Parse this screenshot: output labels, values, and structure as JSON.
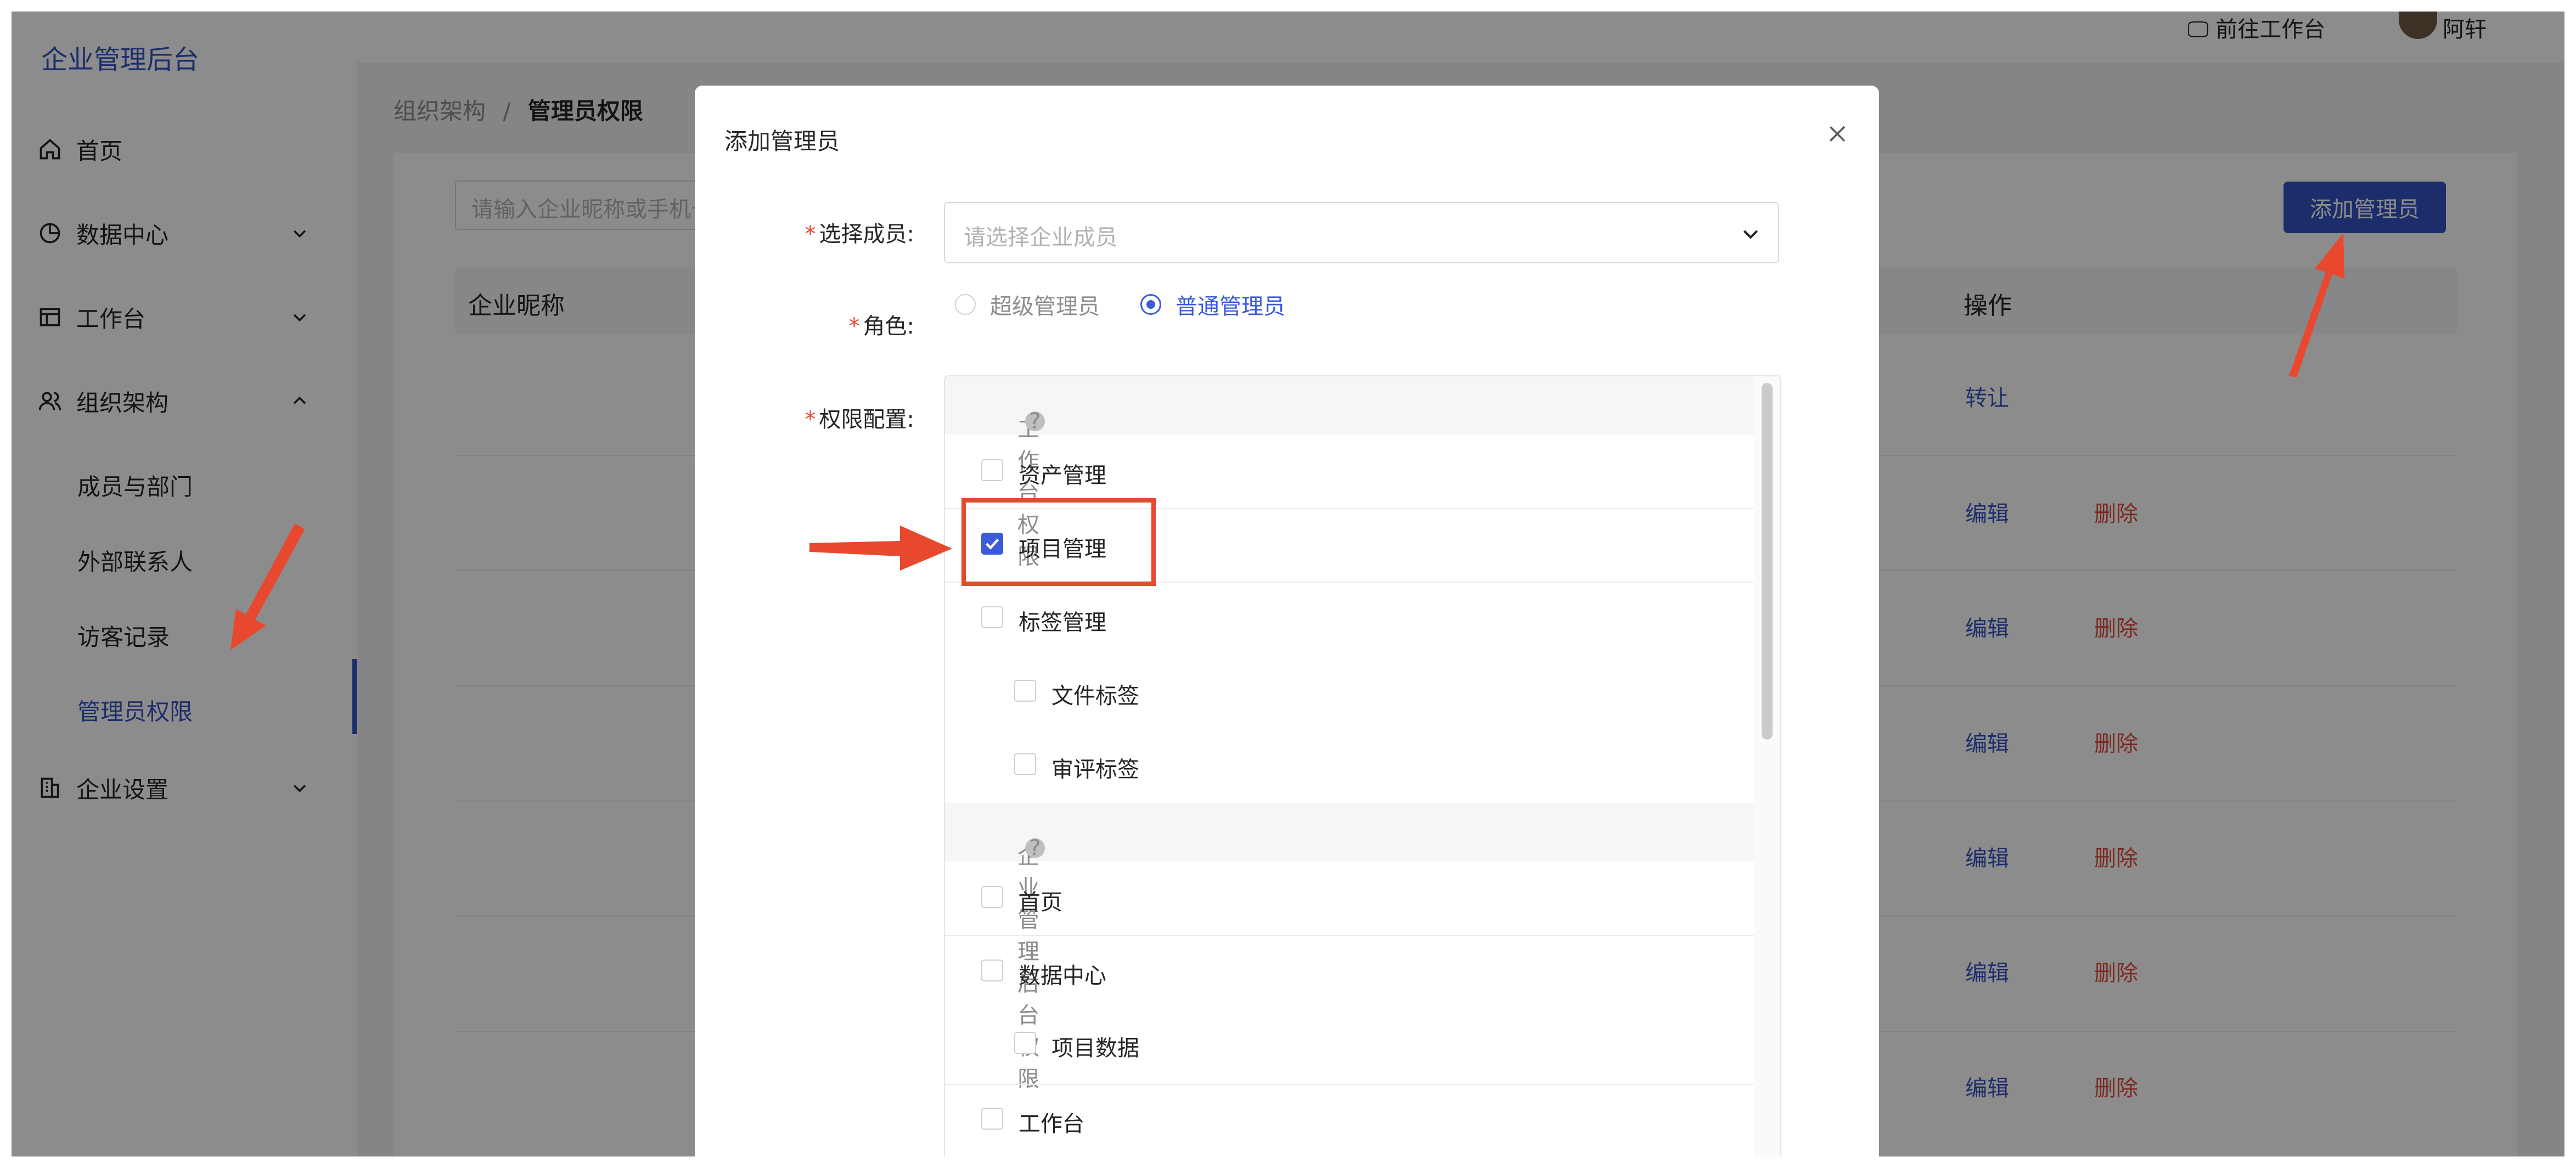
{
  "sidebar": {
    "brand": "企业管理后台",
    "items": [
      {
        "label": "首页",
        "icon": "home-icon"
      },
      {
        "label": "数据中心",
        "icon": "pie-chart-icon"
      },
      {
        "label": "工作台",
        "icon": "workbench-icon"
      },
      {
        "label": "组织架构",
        "icon": "users-icon"
      },
      {
        "label": "企业设置",
        "icon": "building-icon"
      }
    ],
    "sub_items": [
      "成员与部门",
      "外部联系人",
      "访客记录",
      "管理员权限"
    ]
  },
  "header": {
    "link": "前往工作台",
    "user": "阿轩"
  },
  "breadcrumb": {
    "parent": "组织架构",
    "separator": "/",
    "current": "管理员权限"
  },
  "page": {
    "search_placeholder": "请输入企业昵称或手机号",
    "add_button": "添加管理员",
    "columns": {
      "name": "企业昵称",
      "operation": "操作"
    },
    "rows": [
      {
        "action": "转让"
      },
      {
        "edit": "编辑",
        "delete": "删除"
      },
      {
        "edit": "编辑",
        "delete": "删除"
      },
      {
        "edit": "编辑",
        "delete": "删除"
      },
      {
        "edit": "编辑",
        "delete": "删除"
      },
      {
        "edit": "编辑",
        "delete": "删除"
      },
      {
        "edit": "编辑",
        "delete": "删除"
      }
    ]
  },
  "modal": {
    "title": "添加管理员",
    "close_icon": "close-icon",
    "member": {
      "label": "选择成员:",
      "placeholder": "请选择企业成员"
    },
    "role": {
      "label": "角色:",
      "options": [
        "超级管理员",
        "普通管理员"
      ],
      "selected": "普通管理员"
    },
    "permissions": {
      "label": "权限配置:",
      "group1": {
        "title": "工作台权限",
        "items": [
          {
            "label": "资产管理",
            "checked": false
          },
          {
            "label": "项目管理",
            "checked": true
          },
          {
            "label": "标签管理",
            "checked": false
          },
          {
            "label": "文件标签",
            "checked": false
          },
          {
            "label": "审评标签",
            "checked": false
          }
        ]
      },
      "group2": {
        "title": "企业管理后台权限",
        "items": [
          {
            "label": "首页",
            "checked": false
          },
          {
            "label": "数据中心",
            "checked": false
          },
          {
            "label": "项目数据",
            "checked": false
          },
          {
            "label": "工作台",
            "checked": false
          }
        ]
      }
    }
  },
  "colors": {
    "primary": "#3452c4",
    "danger": "#e24a3a",
    "annotation": "#e8482e"
  }
}
